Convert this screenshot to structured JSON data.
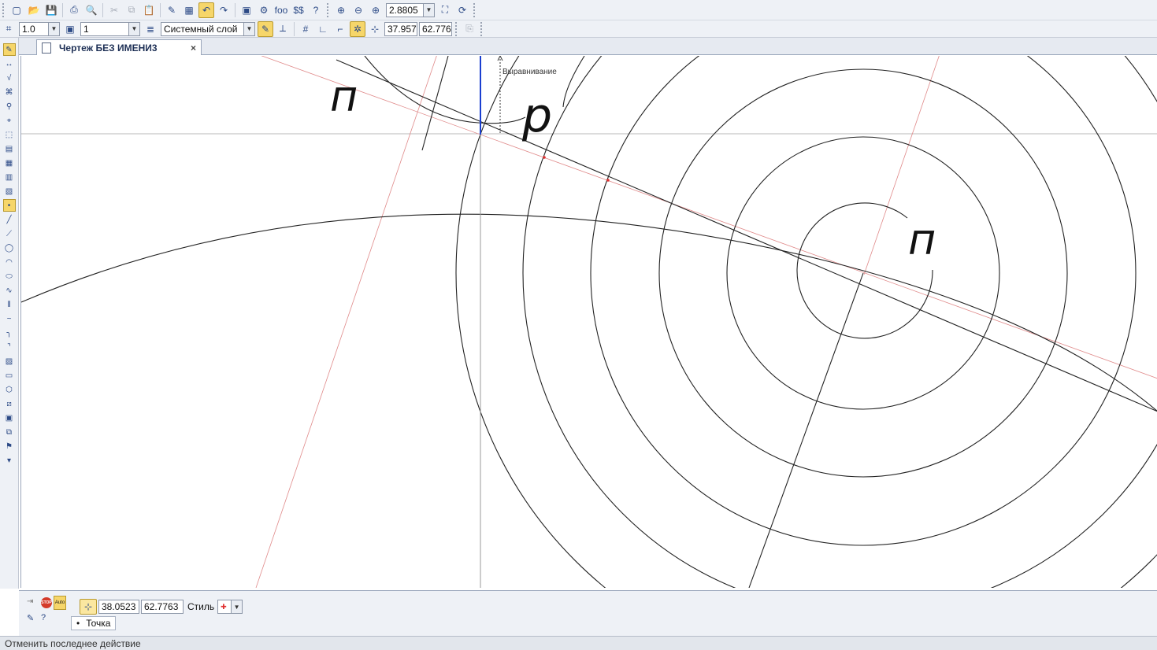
{
  "toolbar_main": {
    "buttons": [
      {
        "name": "new-icon",
        "glyph": "▢"
      },
      {
        "name": "open-icon",
        "glyph": "📂"
      },
      {
        "name": "save-icon",
        "glyph": "💾"
      },
      {
        "name": "print-icon",
        "glyph": "⎙"
      },
      {
        "name": "preview-icon",
        "glyph": "🔍"
      },
      {
        "name": "cut-icon",
        "glyph": "✂"
      },
      {
        "name": "copy-icon",
        "glyph": "⧉"
      },
      {
        "name": "paste-icon",
        "glyph": "📋"
      },
      {
        "name": "properties-icon",
        "glyph": "✎"
      },
      {
        "name": "calculator-icon",
        "glyph": "▦"
      },
      {
        "name": "undo-icon",
        "glyph": "↶"
      },
      {
        "name": "redo-icon",
        "glyph": "↷"
      },
      {
        "name": "manager-icon",
        "glyph": "▣"
      },
      {
        "name": "library-icon",
        "glyph": "⚙"
      },
      {
        "name": "variables-icon",
        "glyph": "foo"
      },
      {
        "name": "measure-icon",
        "glyph": "$$"
      },
      {
        "name": "help-icon",
        "glyph": "?"
      },
      {
        "name": "zoom-window-icon",
        "glyph": "⊕"
      },
      {
        "name": "zoom-out-icon",
        "glyph": "⊖"
      },
      {
        "name": "zoom-in-icon",
        "glyph": "⊕"
      }
    ],
    "zoom_value": "2.8805",
    "view_buttons": [
      {
        "name": "pan-icon",
        "glyph": "⛶"
      },
      {
        "name": "refresh-icon",
        "glyph": "⟳"
      }
    ]
  },
  "toolbar_current_state": {
    "step_value": "1.0",
    "view_value": "1",
    "layer_value": "Системный слой",
    "coord_x": "37.957",
    "coord_y": "62.776"
  },
  "document_tab": {
    "title": "Чертеж БЕЗ ИМЕНИ3",
    "close_glyph": "×"
  },
  "left_toolbar": {
    "buttons": [
      "geometry",
      "dimensions",
      "symbols",
      "edit",
      "params",
      "measure",
      "select",
      "views",
      "spec",
      "reports",
      "insert",
      "point",
      "segment",
      "polyline",
      "circle",
      "arc",
      "ellipse",
      "curve",
      "equidistant",
      "bezier",
      "fillet",
      "chamfer",
      "hatch",
      "rectangle",
      "polygon",
      "contour",
      "macro",
      "assoc",
      "fragment",
      "bottom"
    ]
  },
  "canvas": {
    "hint_text": "Выравнивание",
    "handwritten_labels": [
      "п",
      "р",
      "п"
    ]
  },
  "property_panel": {
    "stop_label": "STOP",
    "auto_label": "Auto",
    "coord_x": "38.0523",
    "coord_y": "62.7763",
    "style_label": "Стиль",
    "point_tab_label": "Точка"
  },
  "status_bar": {
    "text": "Отменить последнее действие"
  },
  "colors": {
    "toolbar_bg": "#eef1f6",
    "active_button": "#f6d66a",
    "construction_line": "#e08a8a",
    "cursor_line": "#1a3fd0"
  }
}
